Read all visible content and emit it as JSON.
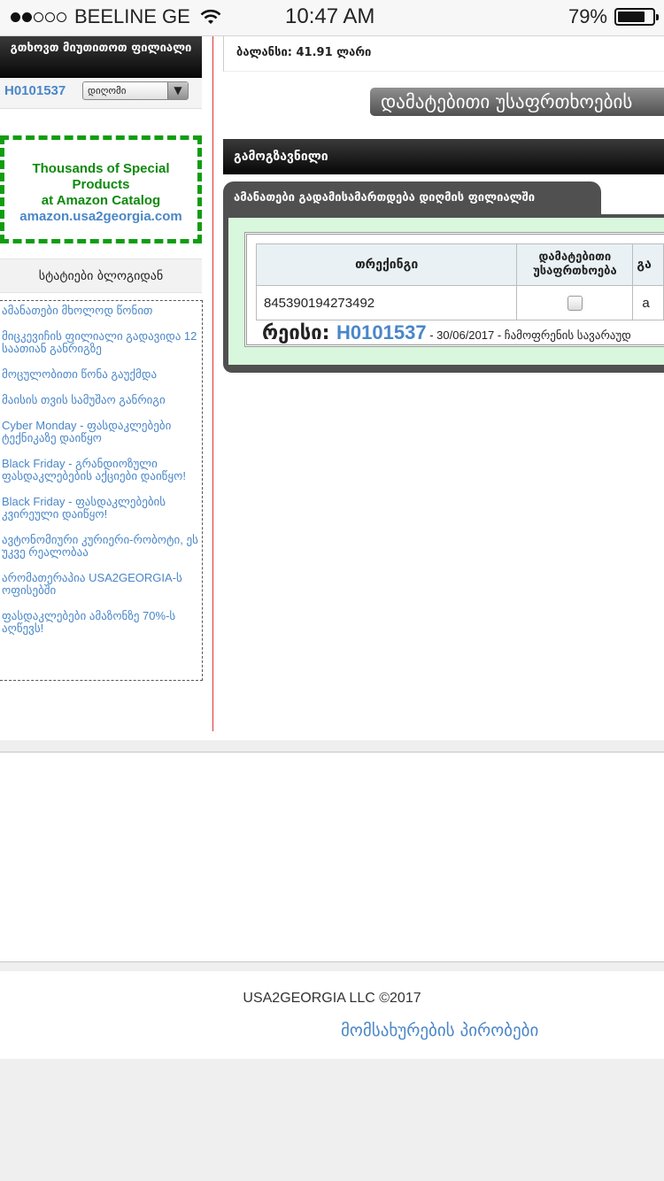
{
  "status_bar": {
    "carrier": "BEELINE GE",
    "time": "10:47 AM",
    "battery": "79%",
    "battery_level": 0.79,
    "signal_bars_filled": 2,
    "signal_bars_total": 5
  },
  "sidebar": {
    "branch_header": "გთხოვთ მიუთითოთ ფილიალი",
    "user_code": "H0101537",
    "branch_select": "დიღომი",
    "promo": {
      "line1": "Thousands of Special Products",
      "line2": "at Amazon Catalog",
      "link": "amazon.usa2georgia.com"
    },
    "blog_title": "სტატიები ბლოგიდან",
    "blog_items": [
      "ამანათები მხოლოდ წონით",
      "მიცკევიჩის ფილიალი გადავიდა 12 საათიან განრიგზე",
      "მოცულობითი წონა გაუქმდა",
      "მაისის თვის სამუშაო განრიგი",
      "Cyber Monday - ფასდაკლებები ტექნიკაზე დაიწყო",
      "Black Friday - გრანდიოზული ფასდაკლებების აქციები დაიწყო!",
      "Black Friday - ფასდაკლებების კვირეული დაიწყო!",
      "ავტონომიური კურიერი-რობოტი, ეს უკვე რეალობაა",
      "არომათერაპია USA2GEORGIA-ს ოფისებში",
      "ფასდაკლებები ამაზონზე 70%-ს აღწევს!"
    ]
  },
  "main": {
    "balance": "ბალანსი: 41.91 ლარი",
    "extra_insurance_button": "დამატებითი უსაფრთხოების",
    "sent_header": "გამოგზავნილი",
    "panel_tab": "ამანათები გადამისამართდება დიღმის ფილიალში",
    "table": {
      "headers": [
        "თრექინგი",
        "დამატებითი უსაფრთხოება",
        "გა"
      ],
      "rows": [
        {
          "tracking": "845390194273492",
          "insurance_checked": false,
          "extra": "a"
        }
      ]
    },
    "trip": {
      "label": "რეისი:",
      "code": "H0101537",
      "details": "- 30/06/2017 - ჩამოფრენის სავარაუდ"
    }
  },
  "footer": {
    "copyright": "USA2GEORGIA LLC ©2017",
    "terms_link": "მომსახურების პირობები"
  }
}
